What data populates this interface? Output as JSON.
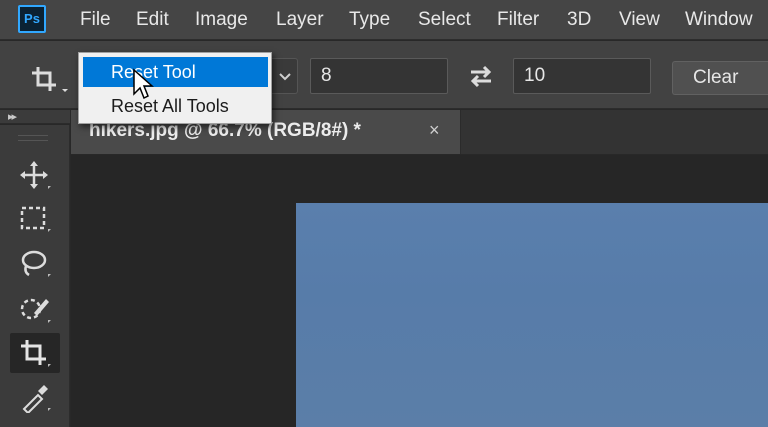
{
  "app": {
    "logo": "Ps"
  },
  "menu": [
    "File",
    "Edit",
    "Image",
    "Layer",
    "Type",
    "Select",
    "Filter",
    "3D",
    "View",
    "Window"
  ],
  "options": {
    "width_value": "8",
    "height_value": "10",
    "clear_label": "Clear"
  },
  "context_menu": {
    "items": [
      "Reset Tool",
      "Reset All Tools"
    ],
    "selected": "Reset Tool"
  },
  "document": {
    "tab_title": "hikers.jpg @ 66.7% (RGB/8#) *",
    "close_glyph": "×"
  },
  "toolbar": {
    "collapse_glyph": "▸▸",
    "tools": [
      "move-tool",
      "rectangular-marquee-tool",
      "lasso-tool",
      "quick-selection-tool",
      "crop-tool",
      "eyedropper-tool"
    ],
    "active_tool": "crop-tool"
  },
  "colors": {
    "accent": "#31a8ff",
    "menu_highlight": "#0078d7",
    "image_sky": "#5a7fad"
  }
}
